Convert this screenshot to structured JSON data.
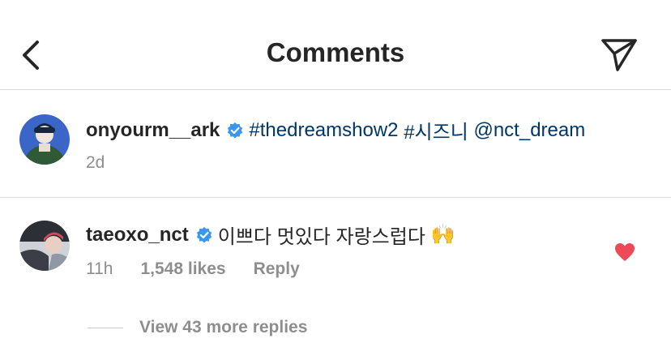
{
  "header": {
    "title": "Comments",
    "back_icon": "chevron-left-icon",
    "send_icon": "paper-plane-icon"
  },
  "caption": {
    "username": "onyourm__ark",
    "verified": true,
    "links": [
      "#thedreamshow2",
      "#시즈니",
      "@nct_dream"
    ],
    "time": "2d"
  },
  "comment": {
    "username": "taeoxo_nct",
    "verified": true,
    "text": "이쁘다 멋있다 자랑스럽다",
    "emoji": "🙌",
    "time": "11h",
    "likes": "1,548 likes",
    "reply_label": "Reply",
    "liked": true,
    "heart_color": "#ed4956",
    "view_replies": "View 43 more replies"
  },
  "colors": {
    "link": "#00376b",
    "verified_badge": "#3897f0",
    "meta_gray": "#8e8e8e",
    "divider": "#dbdbdb"
  }
}
